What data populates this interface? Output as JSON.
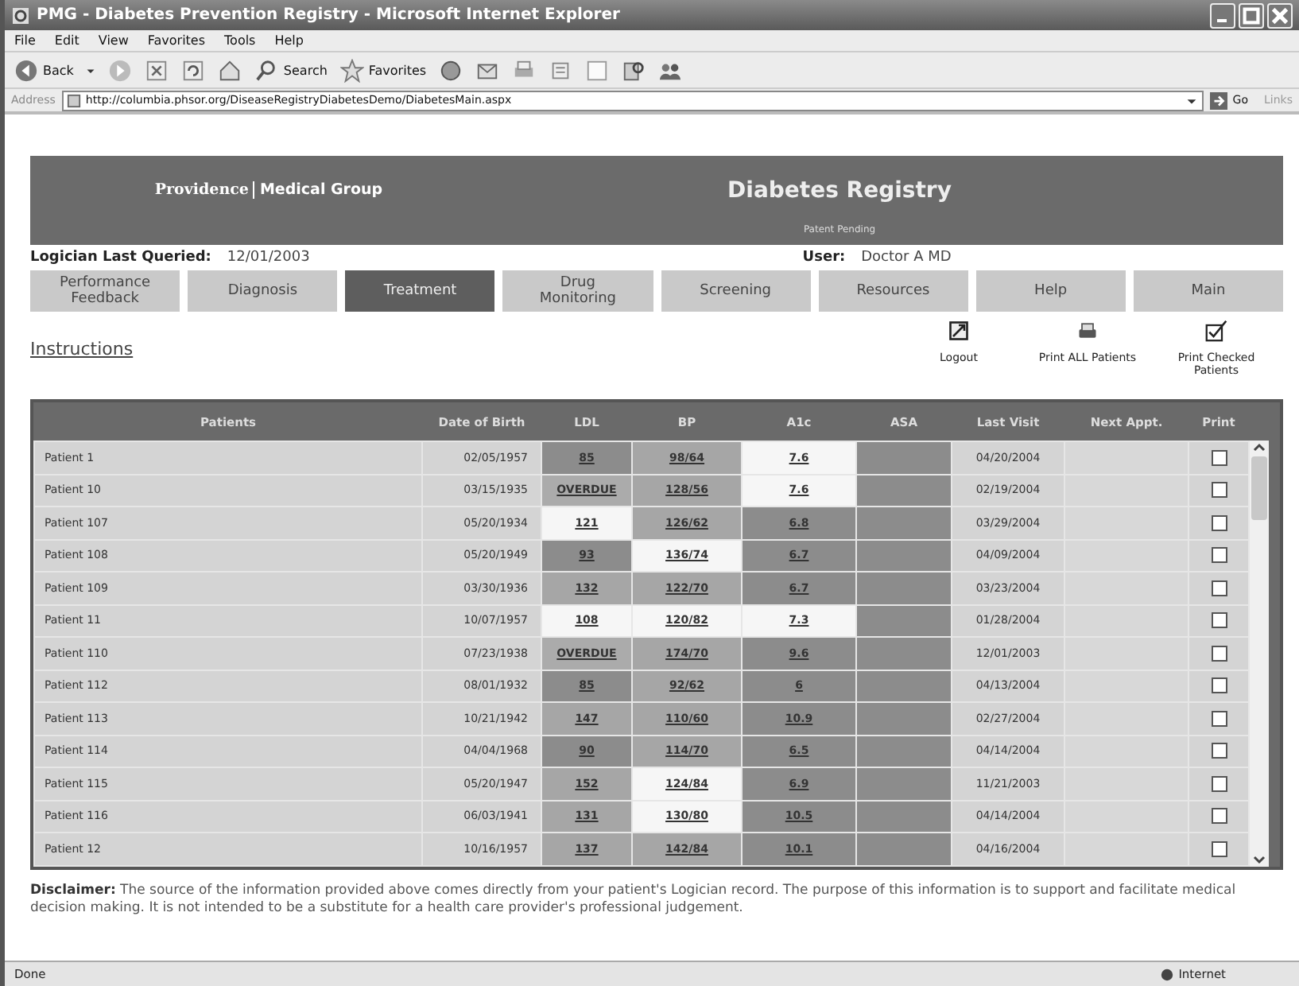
{
  "window": {
    "title": "PMG - Diabetes Prevention Registry - Microsoft Internet Explorer"
  },
  "menu": [
    "File",
    "Edit",
    "View",
    "Favorites",
    "Tools",
    "Help"
  ],
  "toolbar": {
    "back": "Back",
    "search": "Search",
    "favorites": "Favorites"
  },
  "address": {
    "label": "Address",
    "url": "http://columbia.phsor.org/DiseaseRegistryDiabetesDemo/DiabetesMain.aspx",
    "go": "Go",
    "links": "Links"
  },
  "header": {
    "org_first": "Providence",
    "org_second": "Medical Group",
    "title": "Diabetes Registry",
    "subtitle": "Patent Pending"
  },
  "info": {
    "queried_label": "Logician Last Queried:",
    "queried_value": "12/01/2003",
    "user_label": "User:",
    "user_value": "Doctor A MD"
  },
  "tabs": [
    {
      "label": "Performance Feedback",
      "selected": false
    },
    {
      "label": "Diagnosis",
      "selected": false
    },
    {
      "label": "Treatment",
      "selected": true
    },
    {
      "label": "Drug Monitoring",
      "selected": false
    },
    {
      "label": "Screening",
      "selected": false
    },
    {
      "label": "Resources",
      "selected": false
    },
    {
      "label": "Help",
      "selected": false
    },
    {
      "label": "Main",
      "selected": false
    }
  ],
  "instructions_link": "Instructions",
  "actions": [
    {
      "kind": "logout",
      "label": "Logout"
    },
    {
      "kind": "print",
      "label": "Print ALL Patients"
    },
    {
      "kind": "check",
      "label": "Print Checked Patients"
    }
  ],
  "table": {
    "columns": [
      "Patients",
      "Date of Birth",
      "LDL",
      "BP",
      "A1c",
      "ASA",
      "Last Visit",
      "Next Appt.",
      "Print"
    ],
    "rows": [
      {
        "patient": "Patient 1",
        "dob": "02/05/1957",
        "ldl": {
          "text": "85",
          "color": "#8c8c8c"
        },
        "bp": {
          "text": "98/64",
          "color": "#a6a6a6"
        },
        "a1c": {
          "text": "7.6",
          "color": "#f6f6f6"
        },
        "last_visit": "04/20/2004",
        "checked": false
      },
      {
        "patient": "Patient 10",
        "dob": "03/15/1935",
        "ldl": {
          "text": "OVERDUE",
          "color": "#ababab"
        },
        "bp": {
          "text": "128/56",
          "color": "#a6a6a6"
        },
        "a1c": {
          "text": "7.6",
          "color": "#f6f6f6"
        },
        "last_visit": "02/19/2004",
        "checked": false
      },
      {
        "patient": "Patient 107",
        "dob": "05/20/1934",
        "ldl": {
          "text": "121",
          "color": "#f6f6f6"
        },
        "bp": {
          "text": "126/62",
          "color": "#a6a6a6"
        },
        "a1c": {
          "text": "6.8",
          "color": "#8c8c8c"
        },
        "last_visit": "03/29/2004",
        "checked": false
      },
      {
        "patient": "Patient 108",
        "dob": "05/20/1949",
        "ldl": {
          "text": "93",
          "color": "#8c8c8c"
        },
        "bp": {
          "text": "136/74",
          "color": "#f6f6f6"
        },
        "a1c": {
          "text": "6.7",
          "color": "#8c8c8c"
        },
        "last_visit": "04/09/2004",
        "checked": false
      },
      {
        "patient": "Patient 109",
        "dob": "03/30/1936",
        "ldl": {
          "text": "132",
          "color": "#a6a6a6"
        },
        "bp": {
          "text": "122/70",
          "color": "#a6a6a6"
        },
        "a1c": {
          "text": "6.7",
          "color": "#8c8c8c"
        },
        "last_visit": "03/23/2004",
        "checked": false
      },
      {
        "patient": "Patient 11",
        "dob": "10/07/1957",
        "ldl": {
          "text": "108",
          "color": "#f6f6f6"
        },
        "bp": {
          "text": "120/82",
          "color": "#f6f6f6"
        },
        "a1c": {
          "text": "7.3",
          "color": "#f6f6f6"
        },
        "last_visit": "01/28/2004",
        "checked": false
      },
      {
        "patient": "Patient 110",
        "dob": "07/23/1938",
        "ldl": {
          "text": "OVERDUE",
          "color": "#ababab"
        },
        "bp": {
          "text": "174/70",
          "color": "#a6a6a6"
        },
        "a1c": {
          "text": "9.6",
          "color": "#8c8c8c"
        },
        "last_visit": "12/01/2003",
        "checked": false
      },
      {
        "patient": "Patient 112",
        "dob": "08/01/1932",
        "ldl": {
          "text": "85",
          "color": "#8c8c8c"
        },
        "bp": {
          "text": "92/62",
          "color": "#a6a6a6"
        },
        "a1c": {
          "text": "6",
          "color": "#8c8c8c"
        },
        "last_visit": "04/13/2004",
        "checked": false
      },
      {
        "patient": "Patient 113",
        "dob": "10/21/1942",
        "ldl": {
          "text": "147",
          "color": "#a6a6a6"
        },
        "bp": {
          "text": "110/60",
          "color": "#a6a6a6"
        },
        "a1c": {
          "text": "10.9",
          "color": "#8c8c8c"
        },
        "last_visit": "02/27/2004",
        "checked": false
      },
      {
        "patient": "Patient 114",
        "dob": "04/04/1968",
        "ldl": {
          "text": "90",
          "color": "#8c8c8c"
        },
        "bp": {
          "text": "114/70",
          "color": "#a6a6a6"
        },
        "a1c": {
          "text": "6.5",
          "color": "#8c8c8c"
        },
        "last_visit": "04/14/2004",
        "checked": false
      },
      {
        "patient": "Patient 115",
        "dob": "05/20/1947",
        "ldl": {
          "text": "152",
          "color": "#a6a6a6"
        },
        "bp": {
          "text": "124/84",
          "color": "#f6f6f6"
        },
        "a1c": {
          "text": "6.9",
          "color": "#8c8c8c"
        },
        "last_visit": "11/21/2003",
        "checked": false
      },
      {
        "patient": "Patient 116",
        "dob": "06/03/1941",
        "ldl": {
          "text": "131",
          "color": "#a6a6a6"
        },
        "bp": {
          "text": "130/80",
          "color": "#f6f6f6"
        },
        "a1c": {
          "text": "10.5",
          "color": "#8c8c8c"
        },
        "last_visit": "04/14/2004",
        "checked": false
      },
      {
        "patient": "Patient 12",
        "dob": "10/16/1957",
        "ldl": {
          "text": "137",
          "color": "#a6a6a6"
        },
        "bp": {
          "text": "142/84",
          "color": "#a6a6a6"
        },
        "a1c": {
          "text": "10.1",
          "color": "#8c8c8c"
        },
        "last_visit": "04/16/2004",
        "checked": false
      }
    ]
  },
  "disclaimer": "**Disclaimer:** The source of the information provided above comes directly from your patient's Logician record. The purpose of this information is to support and facilitate medical decision making. It is not intended to be a substitute for a health care provider's professional judgement.",
  "status_bar": {
    "left": "Done",
    "right": "Internet"
  }
}
